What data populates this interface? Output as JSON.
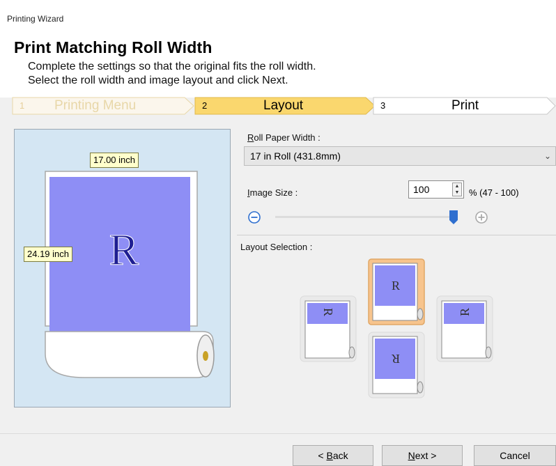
{
  "window": {
    "title": "Printing Wizard"
  },
  "header": {
    "title": "Print Matching Roll Width",
    "description_line1": "Complete the settings so that the original fits the roll width.",
    "description_line2": "Select the roll width and image layout and click Next."
  },
  "steps": [
    {
      "number": "1",
      "label": "Printing Menu",
      "state": "completed"
    },
    {
      "number": "2",
      "label": "Layout",
      "state": "active"
    },
    {
      "number": "3",
      "label": "Print",
      "state": "pending"
    }
  ],
  "preview": {
    "width_label": "17.00 inch",
    "height_label": "24.19 inch",
    "letter": "R"
  },
  "roll_paper": {
    "label_accel": "R",
    "label_rest": "oll Paper Width :",
    "selected": "17 in Roll (431.8mm)"
  },
  "image_size": {
    "label_accel": "I",
    "label_rest": "mage Size :",
    "value": "100",
    "range_text": "% (47 - 100)",
    "min": 47,
    "max": 100
  },
  "layout_selection": {
    "label": "Layout Selection :",
    "options": [
      {
        "letter": "R",
        "orientation": "rotated-left",
        "selected": false
      },
      {
        "letter": "R",
        "orientation": "upright",
        "selected": true
      },
      {
        "letter": "R",
        "orientation": "upside-down",
        "selected": false
      },
      {
        "letter": "R",
        "orientation": "rotated-right",
        "selected": false
      }
    ]
  },
  "buttons": {
    "back_prefix": "< ",
    "back_accel": "B",
    "back_rest": "ack",
    "next_accel": "N",
    "next_rest": "ext >",
    "cancel": "Cancel"
  },
  "colors": {
    "active_step": "#fad76e",
    "paper_image": "#8e8ef5",
    "preview_bg": "#d4e6f3",
    "slider_thumb": "#2f6fcf",
    "selected_option": "#f7c48d"
  },
  "icons": {
    "zoom_out": "minus-circle-icon",
    "zoom_in": "plus-circle-icon",
    "dropdown": "chevron-down-icon",
    "spinner": "up-down-arrows-icon"
  }
}
